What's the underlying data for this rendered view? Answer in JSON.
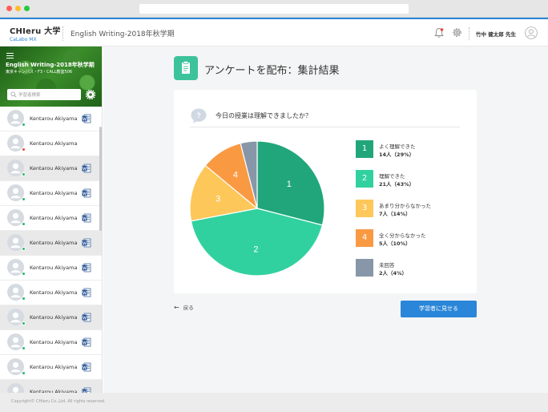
{
  "header": {
    "brand": "CHIeru 大学",
    "brand_sub": "CaLabo MX",
    "course_title": "English Writing-2018年秋学期",
    "teacher": "竹中 健太郎 先生"
  },
  "sidebar": {
    "course": "English Writing-2018年秋学期",
    "place": "東京キャンパス・F3・CALL教室506",
    "search_placeholder": "学習者検索",
    "students": [
      {
        "name": "Kentarou Akiyama",
        "status": "online",
        "doc": true,
        "alt": false
      },
      {
        "name": "Kentarou Akiyama",
        "status": "offline",
        "doc": false,
        "alt": false
      },
      {
        "name": "Kentarou Akiyama",
        "status": "online",
        "doc": true,
        "alt": true
      },
      {
        "name": "Kentarou Akiyama",
        "status": "online",
        "doc": true,
        "alt": false
      },
      {
        "name": "Kentarou Akiyama",
        "status": "online",
        "doc": true,
        "alt": false
      },
      {
        "name": "Kentarou Akiyama",
        "status": "online",
        "doc": true,
        "alt": true
      },
      {
        "name": "Kentarou Akiyama",
        "status": "online",
        "doc": true,
        "alt": false
      },
      {
        "name": "Kentarou Akiyama",
        "status": "online",
        "doc": true,
        "alt": false
      },
      {
        "name": "Kentarou Akiyama",
        "status": "online",
        "doc": true,
        "alt": true
      },
      {
        "name": "Kentarou Akiyama",
        "status": "online",
        "doc": true,
        "alt": false
      },
      {
        "name": "Kentarou Akiyama",
        "status": "online",
        "doc": true,
        "alt": false
      },
      {
        "name": "Kentarou Akiyama",
        "status": "online",
        "doc": true,
        "alt": true
      }
    ]
  },
  "main": {
    "page_title": "アンケートを配布：集計結果",
    "question": "今日の授業は理解できましたか？",
    "back_label": "戻る",
    "show_button": "学習者に見せる"
  },
  "colors": {
    "accent": "#2a86d8",
    "online": "#2bb673",
    "offline": "#e8473b"
  },
  "chart_data": {
    "type": "pie",
    "start_angle_deg": 0,
    "slices": [
      {
        "num": "1",
        "label": "よく理解できた",
        "count": "14人（29%）",
        "value": 29,
        "color": "#21a67b"
      },
      {
        "num": "2",
        "label": "理解できた",
        "count": "21人（43%）",
        "value": 43,
        "color": "#31d19f"
      },
      {
        "num": "3",
        "label": "あまり分からなかった",
        "count": "7人（14%）",
        "value": 14,
        "color": "#fdc75a"
      },
      {
        "num": "4",
        "label": "全く分からなかった",
        "count": "5人（10%）",
        "value": 10,
        "color": "#f99a43"
      },
      {
        "num": "",
        "label": "未回答",
        "count": "2人（4%）",
        "value": 4,
        "color": "#8797a9"
      }
    ]
  },
  "footer": {
    "copyright": "Copyright© CHIeru Co.,Ltd. All rights reserved."
  }
}
